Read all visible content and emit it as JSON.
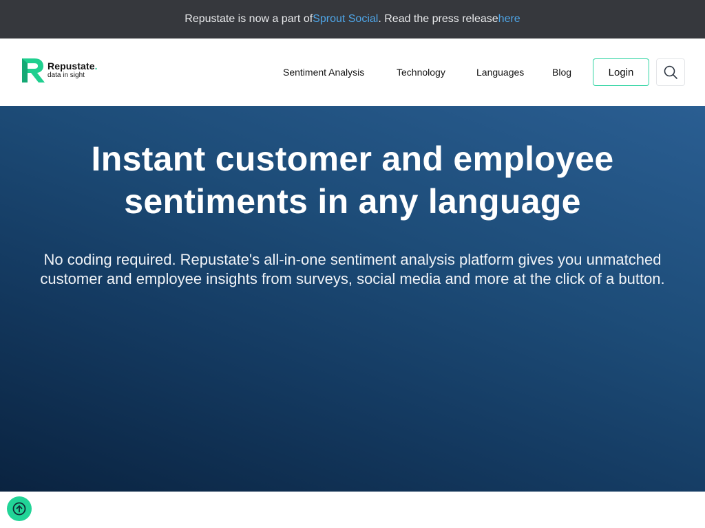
{
  "announcement": {
    "prefix": "Repustate is now a part of ",
    "link_text": "Sprout Social",
    "middle": ". Read the press release ",
    "here_text": "here"
  },
  "logo": {
    "name": "Repustate",
    "dot": ".",
    "tagline": "data in sight"
  },
  "nav": {
    "items": [
      {
        "label": "Sentiment Analysis"
      },
      {
        "label": "Technology"
      },
      {
        "label": "Languages"
      },
      {
        "label": "Blog"
      }
    ],
    "login_label": "Login",
    "search_icon": "search-icon"
  },
  "hero": {
    "title_line1": "Instant customer and employee",
    "title_line2": "sentiments in any language",
    "subtitle": "No coding required. Repustate's all-in-one sentiment analysis platform gives you unmatched customer and employee insights from surveys, social media and more at the click of a button."
  },
  "scroll_top": {
    "icon": "arrow-up-circle-icon"
  },
  "colors": {
    "brand_green": "#20c997",
    "link_blue": "#4fa6e8",
    "announce_bg": "#36383d",
    "hero_bg": "#1d4c78"
  }
}
